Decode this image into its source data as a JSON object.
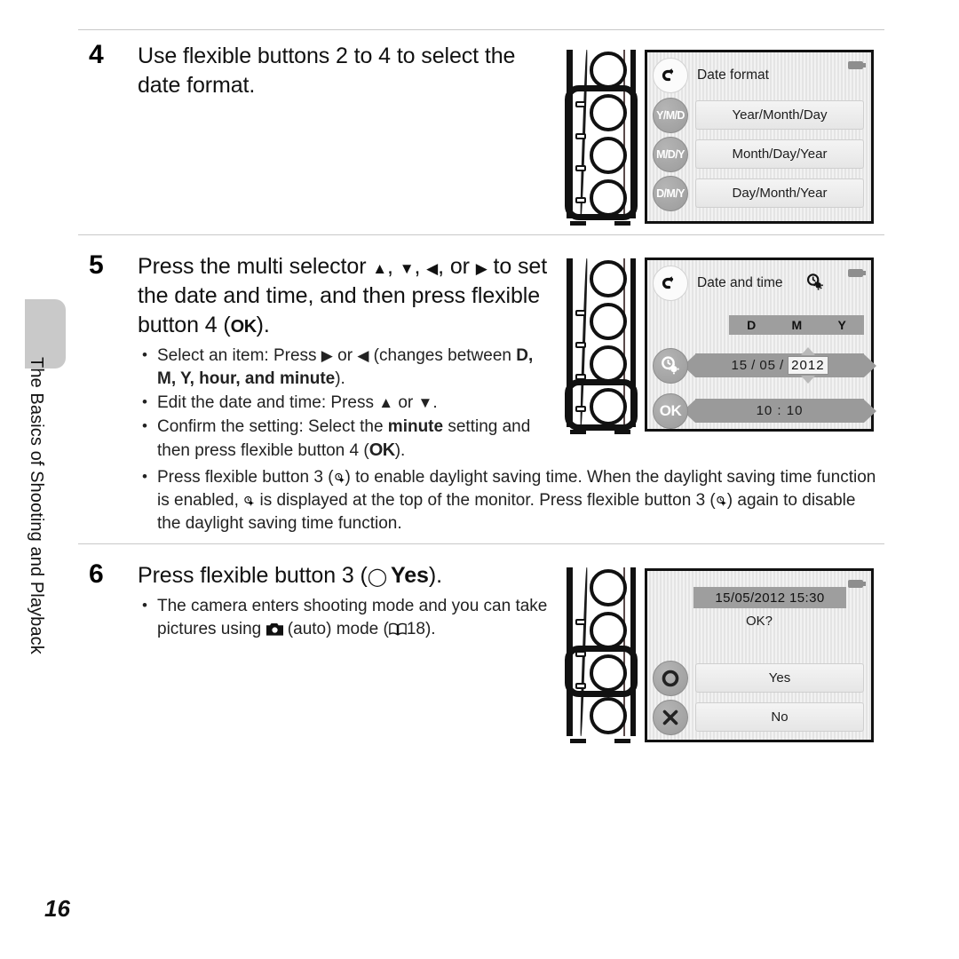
{
  "page": {
    "number": "16",
    "chapter_tab_label": "The Basics of Shooting and Playback"
  },
  "steps": [
    {
      "number": "4",
      "heading": "Use flexible buttons 2 to 4 to select the date format.",
      "screen": {
        "name": "date-format-menu",
        "title": "Date format",
        "back_icon": "back-arrow-icon",
        "battery_icon": "battery-icon",
        "options": [
          {
            "badge": "Y/M/D",
            "label": "Year/Month/Day"
          },
          {
            "badge": "M/D/Y",
            "label": "Month/Day/Year"
          },
          {
            "badge": "D/M/Y",
            "label": "Day/Month/Year"
          }
        ]
      },
      "camera": {
        "highlight": "buttons-2-to-4"
      }
    },
    {
      "number": "5",
      "heading_parts": {
        "a": "Press the multi selector ",
        "up": "▲",
        "b": ", ",
        "down": "▼",
        "c": ", ",
        "left": "◀",
        "d": ", or ",
        "right": "▶",
        "e": " to set the date and time, and then press flexible button 4 (",
        "ok": "OK",
        "f": ")."
      },
      "bullets": [
        {
          "text_a": "Select an item: Press ",
          "g1": "▶",
          "text_b": " or ",
          "g2": "◀",
          "text_c": " (changes between ",
          "bold_list": "D, M, Y, hour, and minute",
          "text_d": ")."
        },
        {
          "text_a": "Edit the date and time: Press ",
          "g1": "▲",
          "text_b": " or ",
          "g2": "▼",
          "text_c": "."
        },
        {
          "text_a": "Confirm the setting: Select the ",
          "bold_a": "minute",
          "text_b": " setting and then press flexible button 4 (",
          "ok": "OK",
          "text_c": ")."
        },
        {
          "text_a": "Press flexible button 3 (",
          "dst": "daylight-saving-icon",
          "text_b": ") to enable daylight saving time. When the daylight saving time function is enabled, ",
          "text_c": " is displayed at the top of the monitor. Press flexible button 3 (",
          "text_d": ") again to disable the daylight saving time function."
        }
      ],
      "screen": {
        "name": "date-and-time-screen",
        "title": "Date and time",
        "back_icon": "back-arrow-icon",
        "battery_icon": "battery-icon",
        "daylight_icon": "daylight-saving-icon",
        "column_headers": [
          "D",
          "M",
          "Y"
        ],
        "date_day": "15",
        "date_sep1": "/",
        "date_month": "05",
        "date_sep2": "/",
        "date_year": "2012",
        "time_value": "10 : 10",
        "ok_badge": "OK"
      },
      "camera": {
        "highlight": "button-4"
      }
    },
    {
      "number": "6",
      "heading_parts": {
        "a": "Press flexible button 3 (",
        "circle": "◯",
        "yes": "Yes",
        "b": ")."
      },
      "bullets": [
        {
          "text_a": "The camera enters shooting mode and you can take pictures using ",
          "cam": "camera-icon",
          "text_b": " (auto) mode (",
          "book": "book-icon",
          "page_ref": "18",
          "text_c": ")."
        }
      ],
      "screen": {
        "name": "confirm-datetime-screen",
        "timestamp": "15/05/2012 15:30",
        "question": "OK?",
        "battery_icon": "battery-icon",
        "options": [
          {
            "badge": "circle-icon",
            "label": "Yes"
          },
          {
            "badge": "cross-icon",
            "label": "No"
          }
        ]
      },
      "camera": {
        "highlight": "button-3"
      }
    }
  ]
}
